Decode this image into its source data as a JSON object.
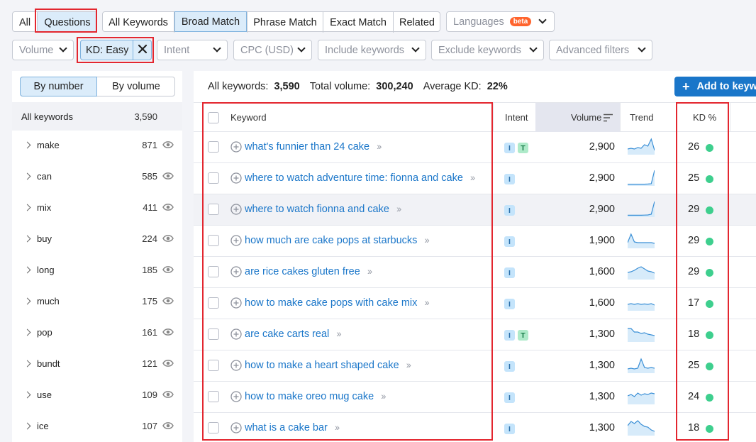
{
  "toolbar": {
    "tabs": [
      "All",
      "Questions"
    ],
    "match": [
      "All Keywords",
      "Broad Match",
      "Phrase Match",
      "Exact Match",
      "Related"
    ],
    "languages": "Languages",
    "beta": "beta"
  },
  "filters": {
    "volume": "Volume",
    "kd_easy": "KD: Easy",
    "intent": "Intent",
    "cpc": "CPC (USD)",
    "include": "Include keywords",
    "exclude": "Exclude keywords",
    "advanced": "Advanced filters"
  },
  "sidebar": {
    "toggle": [
      "By number",
      "By volume"
    ],
    "all_label": "All keywords",
    "all_count": "3,590",
    "groups": [
      {
        "label": "make",
        "count": "871"
      },
      {
        "label": "can",
        "count": "585"
      },
      {
        "label": "mix",
        "count": "411"
      },
      {
        "label": "buy",
        "count": "224"
      },
      {
        "label": "long",
        "count": "185"
      },
      {
        "label": "much",
        "count": "175"
      },
      {
        "label": "pop",
        "count": "161"
      },
      {
        "label": "bundt",
        "count": "121"
      },
      {
        "label": "use",
        "count": "109"
      },
      {
        "label": "ice",
        "count": "107"
      }
    ]
  },
  "summary": {
    "all_label": "All keywords:",
    "all_value": "3,590",
    "vol_label": "Total volume:",
    "vol_value": "300,240",
    "kd_label": "Average KD:",
    "kd_value": "22%",
    "add_button": "Add to keyw"
  },
  "table": {
    "headers": {
      "keyword": "Keyword",
      "intent": "Intent",
      "volume": "Volume",
      "trend": "Trend",
      "kd": "KD %"
    },
    "rows": [
      {
        "keyword": "what's funnier than 24 cake",
        "intent": [
          "I",
          "T"
        ],
        "volume": "2,900",
        "kd": "26",
        "trend": [
          0.3,
          0.35,
          0.3,
          0.4,
          0.35,
          0.6,
          0.5,
          1.0,
          0.2
        ]
      },
      {
        "keyword": "where to watch adventure time: fionna and cake",
        "intent": [
          "I"
        ],
        "volume": "2,900",
        "kd": "25",
        "trend": [
          0.02,
          0.02,
          0.02,
          0.02,
          0.02,
          0.02,
          0.03,
          0.05,
          1.0
        ]
      },
      {
        "keyword": "where to watch fionna and cake",
        "intent": [
          "I"
        ],
        "volume": "2,900",
        "kd": "29",
        "trend": [
          0.03,
          0.03,
          0.03,
          0.03,
          0.03,
          0.04,
          0.05,
          0.1,
          1.0
        ]
      },
      {
        "keyword": "how much are cake pops at starbucks",
        "intent": [
          "I"
        ],
        "volume": "1,900",
        "kd": "29",
        "trend": [
          0.3,
          0.9,
          0.35,
          0.3,
          0.3,
          0.3,
          0.3,
          0.3,
          0.25
        ]
      },
      {
        "keyword": "are rice cakes gluten free",
        "intent": [
          "I"
        ],
        "volume": "1,600",
        "kd": "29",
        "trend": [
          0.4,
          0.45,
          0.55,
          0.7,
          0.8,
          0.65,
          0.5,
          0.45,
          0.35
        ]
      },
      {
        "keyword": "how to make cake pops with cake mix",
        "intent": [
          "I"
        ],
        "volume": "1,600",
        "kd": "17",
        "trend": [
          0.35,
          0.4,
          0.35,
          0.4,
          0.35,
          0.38,
          0.35,
          0.4,
          0.3
        ]
      },
      {
        "keyword": "are cake carts real",
        "intent": [
          "I",
          "T"
        ],
        "volume": "1,300",
        "kd": "18",
        "trend": [
          0.85,
          0.85,
          0.6,
          0.6,
          0.5,
          0.55,
          0.45,
          0.4,
          0.35
        ]
      },
      {
        "keyword": "how to make a heart shaped cake",
        "intent": [
          "I"
        ],
        "volume": "1,300",
        "kd": "25",
        "trend": [
          0.2,
          0.25,
          0.2,
          0.25,
          0.9,
          0.3,
          0.25,
          0.3,
          0.25
        ]
      },
      {
        "keyword": "how to make oreo mug cake",
        "intent": [
          "I"
        ],
        "volume": "1,300",
        "kd": "24",
        "trend": [
          0.5,
          0.6,
          0.45,
          0.7,
          0.55,
          0.65,
          0.6,
          0.7,
          0.65
        ]
      },
      {
        "keyword": "what is a cake bar",
        "intent": [
          "I"
        ],
        "volume": "1,300",
        "kd": "18",
        "trend": [
          0.6,
          0.9,
          0.75,
          0.95,
          0.7,
          0.55,
          0.5,
          0.3,
          0.2
        ]
      }
    ]
  },
  "colors": {
    "accent": "#1a76c9",
    "highlight": "#e3262f",
    "kd_easy": "#3ecf8e",
    "active_bg": "#dbecfa"
  }
}
